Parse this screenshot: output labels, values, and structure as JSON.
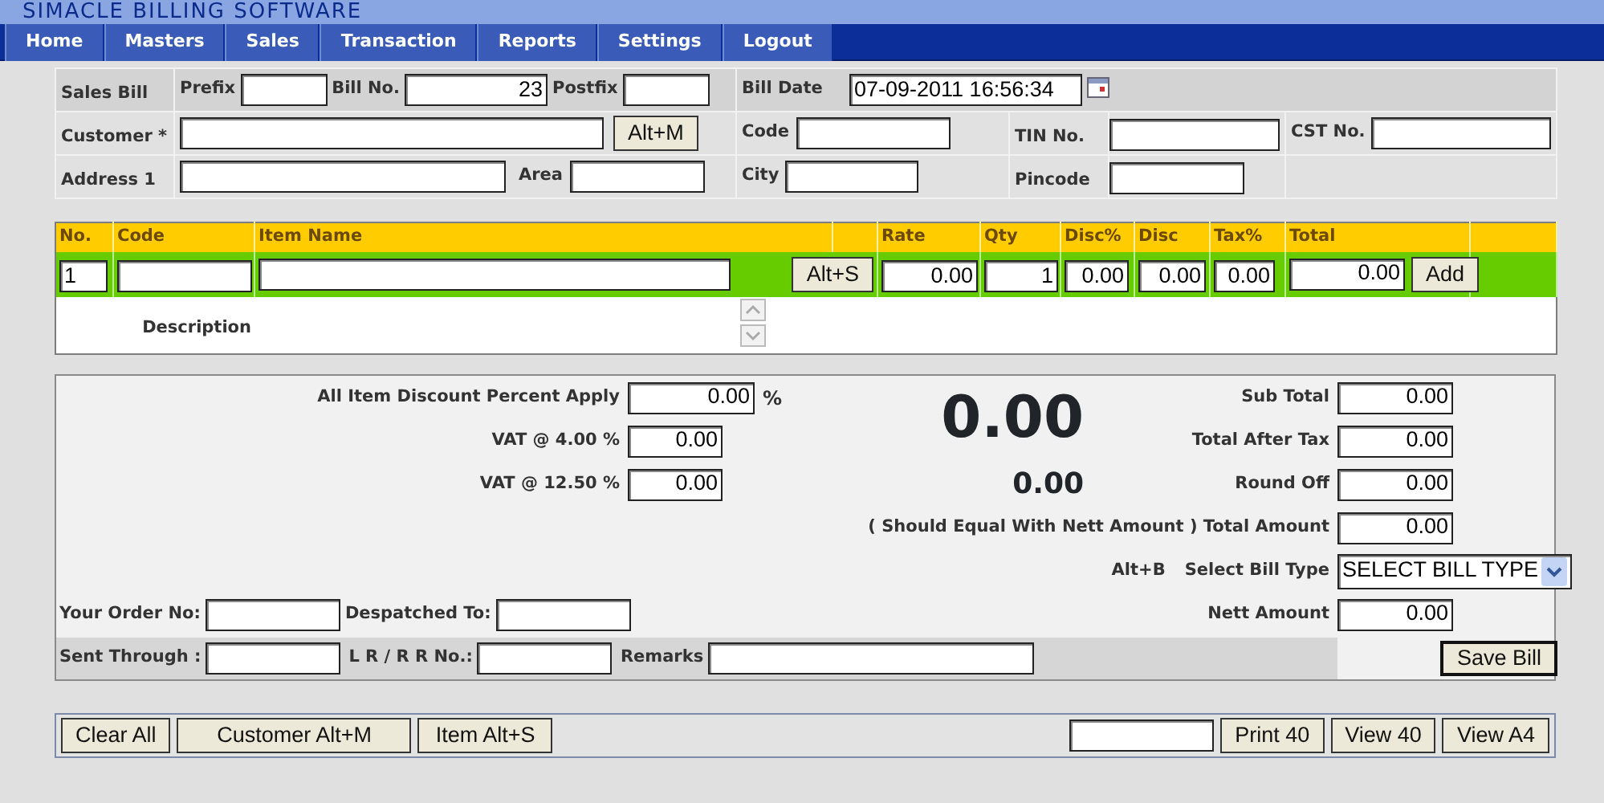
{
  "app": {
    "title": "SIMACLE BILLING SOFTWARE"
  },
  "menu": [
    {
      "label": "Home"
    },
    {
      "label": "Masters"
    },
    {
      "label": "Sales"
    },
    {
      "label": "Transaction"
    },
    {
      "label": "Reports"
    },
    {
      "label": "Settings"
    },
    {
      "label": "Logout"
    }
  ],
  "bill_header": {
    "title": "Sales Bill",
    "prefix_label": "Prefix",
    "bill_no_label": "Bill No.",
    "bill_no": "23",
    "postfix_label": "Postfix",
    "bill_date_label": "Bill Date",
    "bill_date": "07-09-2011 16:56:34",
    "customer_label": "Customer *",
    "customer_button": "Alt+M",
    "code_label": "Code",
    "tin_label": "TIN No.",
    "cst_label": "CST No.",
    "address_label": "Address 1",
    "area_label": "Area",
    "city_label": "City",
    "pincode_label": "Pincode"
  },
  "item_grid": {
    "columns": [
      "No.",
      "Code",
      "Item Name",
      "Rate",
      "Qty",
      "Disc%",
      "Disc",
      "Tax%",
      "Total"
    ],
    "entry": {
      "no": "1",
      "lookup_button": "Alt+S",
      "rate": "0.00",
      "qty": "1",
      "disc_pct": "0.00",
      "disc": "0.00",
      "tax_pct": "0.00",
      "total": "0.00",
      "add_button": "Add"
    },
    "description_label": "Description"
  },
  "summary": {
    "discount_label": "All Item Discount Percent Apply",
    "discount": "0.00",
    "percent_sign": "%",
    "vat": [
      {
        "label": "VAT @ 4.00 %",
        "value": "0.00"
      },
      {
        "label": "VAT @ 12.50 %",
        "value": "0.00"
      }
    ],
    "big_total": "0.00",
    "small_total": "0.00",
    "totals": [
      {
        "label": "Sub Total",
        "value": "0.00"
      },
      {
        "label": "Total After Tax",
        "value": "0.00"
      },
      {
        "label": "Round Off",
        "value": "0.00"
      },
      {
        "label": "( Should Equal With Nett Amount ) Total Amount",
        "value": "0.00"
      }
    ],
    "bill_type_hotkey": "Alt+B",
    "bill_type_label": "Select Bill Type",
    "bill_type": "SELECT BILL TYPE",
    "nett_label": "Nett Amount",
    "nett": "0.00",
    "order_label": "Your Order No:",
    "despatched_label": "Despatched To:",
    "sent_label": "Sent Through :",
    "lr_label": "L R / R R No.:",
    "remarks_label": "Remarks",
    "save_button": "Save Bill"
  },
  "actions": {
    "left": [
      "Clear All",
      "Customer Alt+M",
      "Item Alt+S"
    ],
    "right": [
      "Print 40",
      "View 40",
      "View A4"
    ]
  }
}
